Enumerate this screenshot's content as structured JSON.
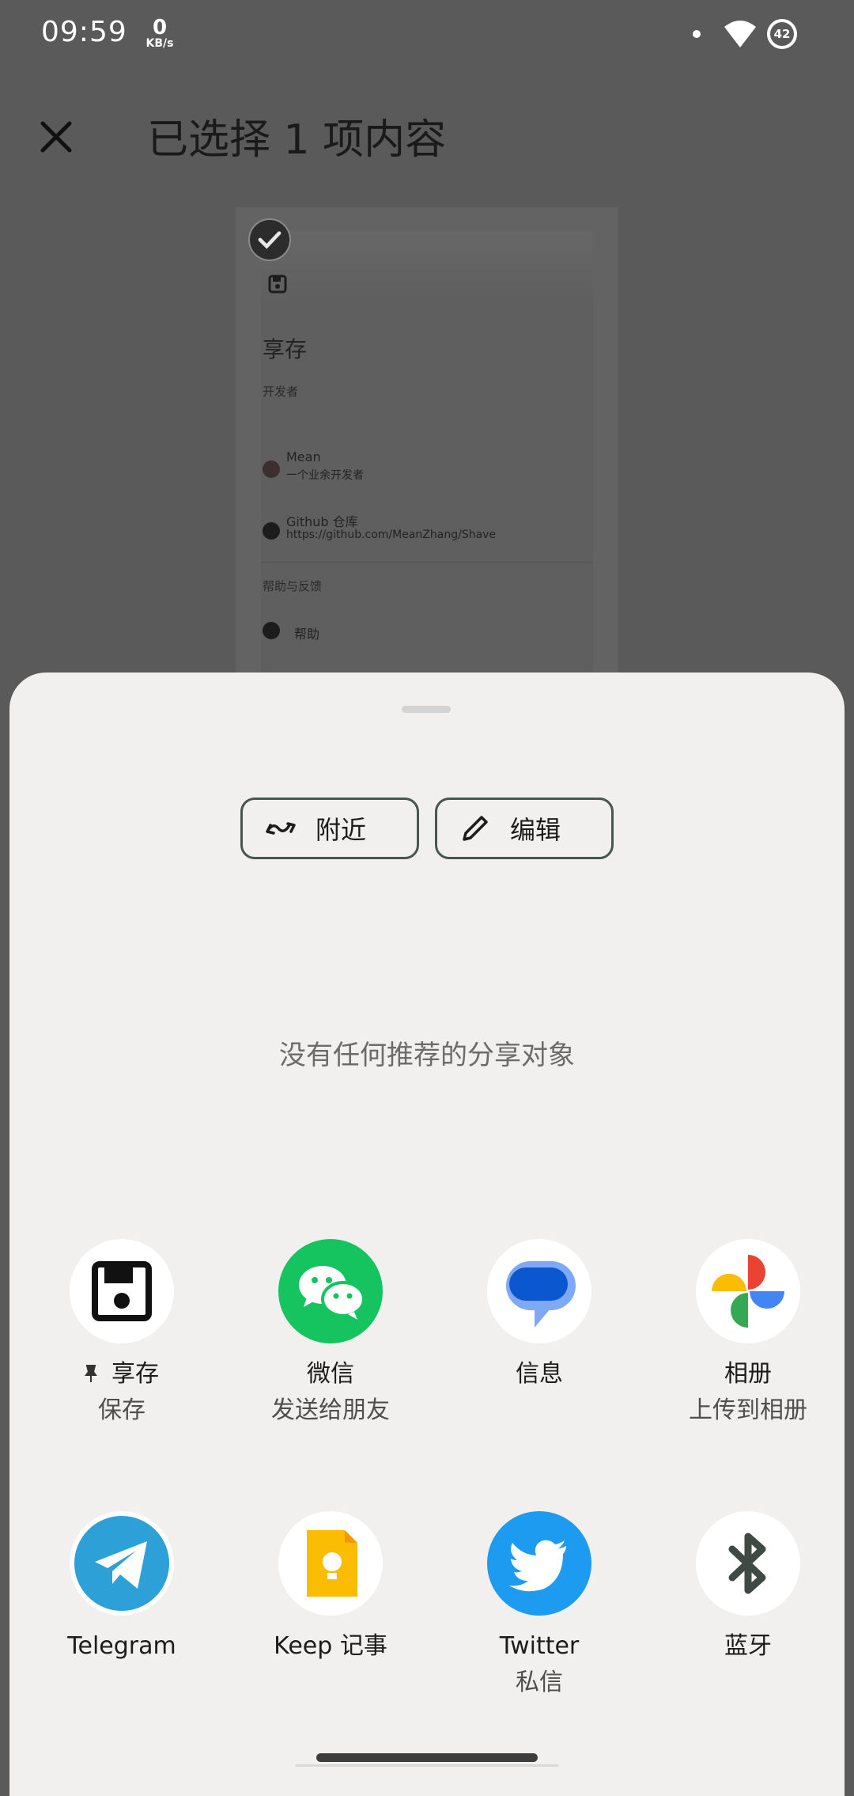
{
  "status_bar": {
    "time": "09:59",
    "net_speed": "0",
    "net_unit": "KB/s",
    "battery": "42"
  },
  "header": {
    "title": "已选择 1 项内容"
  },
  "preview": {
    "app_title": "享存",
    "section_dev": "开发者",
    "dev_name": "Mean",
    "dev_desc": "一个业余开发者",
    "repo_title": "Github 仓库",
    "repo_url": "https://github.com/MeanZhang/Shave",
    "section_help": "帮助与反馈",
    "help": "帮助"
  },
  "sheet": {
    "nearby_label": "附近",
    "edit_label": "编辑",
    "empty_message": "没有任何推荐的分享对象",
    "apps": [
      {
        "name": "享存",
        "sub": "保存",
        "icon": "save-icon",
        "pinned": true
      },
      {
        "name": "微信",
        "sub": "发送给朋友",
        "icon": "wechat-icon"
      },
      {
        "name": "信息",
        "sub": "",
        "icon": "messages-icon"
      },
      {
        "name": "相册",
        "sub": "上传到相册",
        "icon": "photos-icon"
      },
      {
        "name": "Telegram",
        "sub": "",
        "icon": "telegram-icon"
      },
      {
        "name": "Keep 记事",
        "sub": "",
        "icon": "keep-icon"
      },
      {
        "name": "Twitter",
        "sub": "私信",
        "icon": "twitter-icon"
      },
      {
        "name": "蓝牙",
        "sub": "",
        "icon": "bluetooth-icon"
      }
    ]
  }
}
